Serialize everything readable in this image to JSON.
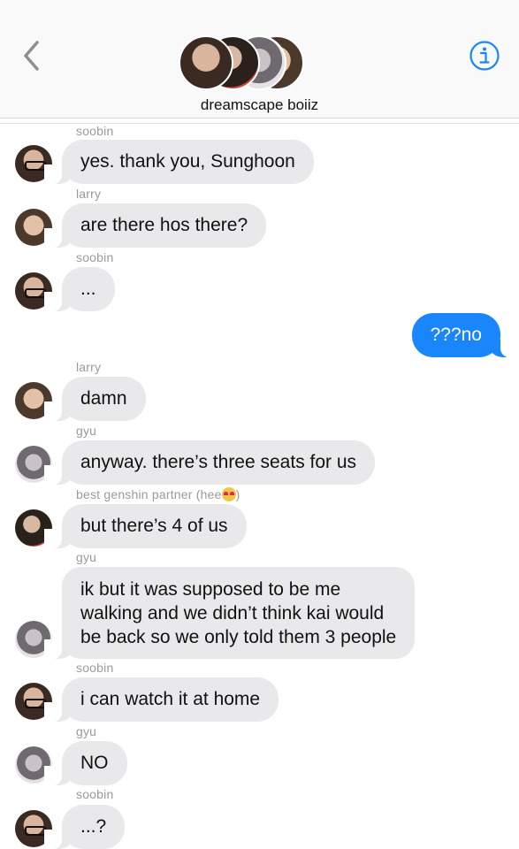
{
  "header": {
    "group_name": "dreamscape boiiz",
    "back_icon": "chevron-left-icon",
    "info_icon": "info-circle-icon",
    "accent_color": "#1a86fb"
  },
  "messages": [
    {
      "sender": "soobin",
      "text": "yes. thank you, Sunghoon"
    },
    {
      "sender": "larry",
      "text": "are there hos there?"
    },
    {
      "sender": "soobin",
      "text": "..."
    },
    {
      "outgoing": true,
      "text": "???no"
    },
    {
      "sender": "larry",
      "text": "damn"
    },
    {
      "sender": "gyu",
      "text": "anyway. there’s three seats for us"
    },
    {
      "sender": "best genshin partner (hee",
      "sender_suffix": ")",
      "sender_emoji": "heart-eyes-emoji",
      "text": "but there’s 4 of us"
    },
    {
      "sender": "gyu",
      "lines": [
        "ik but it was supposed to be me",
        "walking and we didn’t think kai would",
        "be back so we only told them 3 people"
      ]
    },
    {
      "sender": "soobin",
      "text": "i can watch it at home"
    },
    {
      "sender": "gyu",
      "text": "NO"
    },
    {
      "sender": "soobin",
      "text": "...?"
    }
  ]
}
